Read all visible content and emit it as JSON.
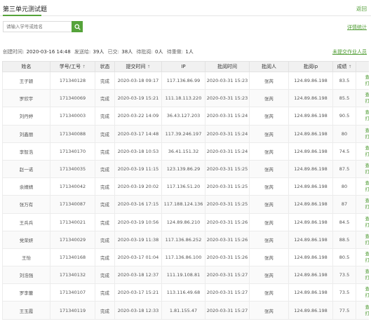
{
  "header": {
    "title": "第三单元测试题",
    "back": "返回"
  },
  "search": {
    "placeholder": "请输入学号或姓名",
    "detail_link": "详情统计"
  },
  "stats": {
    "created_label": "创建时间:",
    "created_value": "2020-03-16 14:48",
    "sent_label": "发送给:",
    "sent_value": "39人",
    "submitted_label": "已交:",
    "submitted_value": "38人",
    "pending_label": "待批阅:",
    "pending_value": "0人",
    "redo_label": "待重做:",
    "redo_value": "1人",
    "unsubmitted_link": "未提交作业人员"
  },
  "table": {
    "headers": [
      "姓名",
      "学号/工号",
      "状态",
      "提交时间",
      "IP",
      "批阅时间",
      "批阅人",
      "批阅ip",
      "成绩",
      ""
    ],
    "actions": {
      "view": "查看",
      "redo": "打回"
    },
    "rows": [
      [
        "王子颖",
        "171340128",
        "完成",
        "2020-03-18 09:17",
        "117.136.86.99",
        "2020-03-31 15:23",
        "张芮",
        "124.89.86.198",
        "83.5"
      ],
      [
        "罗欣宇",
        "171340069",
        "完成",
        "2020-03-19 15:21",
        "111.18.113.220",
        "2020-03-31 15:23",
        "张芮",
        "124.89.86.198",
        "85.5"
      ],
      [
        "刘丹婷",
        "171340003",
        "完成",
        "2020-03-22 14:09",
        "36.43.127.203",
        "2020-03-31 15:24",
        "张芮",
        "124.89.86.198",
        "90.5"
      ],
      [
        "刘鑫丽",
        "171340088",
        "完成",
        "2020-03-17 14:48",
        "117.39.246.197",
        "2020-03-31 15:24",
        "张芮",
        "124.89.86.198",
        "80"
      ],
      [
        "李智浩",
        "171340170",
        "完成",
        "2020-03-18 10:53",
        "36.41.151.32",
        "2020-03-31 15:24",
        "张芮",
        "124.89.86.198",
        "74.5"
      ],
      [
        "赵一诺",
        "171340035",
        "完成",
        "2020-03-19 11:15",
        "123.139.86.29",
        "2020-03-31 15:25",
        "张芮",
        "124.89.86.198",
        "87.5"
      ],
      [
        "余婧婧",
        "171340042",
        "完成",
        "2020-03-19 20:02",
        "117.136.51.20",
        "2020-03-31 15:25",
        "张芮",
        "124.89.86.198",
        "80"
      ],
      [
        "张万有",
        "171340087",
        "完成",
        "2020-03-16 17:15",
        "117.188.124.136",
        "2020-03-31 15:25",
        "张芮",
        "124.89.86.198",
        "87"
      ],
      [
        "王兵兵",
        "171340021",
        "完成",
        "2020-03-19 10:56",
        "124.89.86.210",
        "2020-03-31 15:26",
        "张芮",
        "124.89.86.198",
        "84.5"
      ],
      [
        "党荣妍",
        "171340029",
        "完成",
        "2020-03-19 11:38",
        "117.136.86.252",
        "2020-03-31 15:26",
        "张芮",
        "124.89.86.198",
        "88.5"
      ],
      [
        "王怡",
        "171340168",
        "完成",
        "2020-03-17 01:04",
        "117.136.86.100",
        "2020-03-31 15:26",
        "张芮",
        "124.89.86.198",
        "80.5"
      ],
      [
        "刘浩强",
        "171340132",
        "完成",
        "2020-03-18 12:37",
        "111.19.108.81",
        "2020-03-31 15:27",
        "张芮",
        "124.89.86.198",
        "73.5"
      ],
      [
        "罗李蕾",
        "171340107",
        "完成",
        "2020-03-17 15:21",
        "113.116.49.68",
        "2020-03-31 15:27",
        "张芮",
        "124.89.86.198",
        "73.5"
      ],
      [
        "王玉霞",
        "171340119",
        "完成",
        "2020-03-18 12:33",
        "1.81.155.47",
        "2020-03-31 15:27",
        "张芮",
        "124.89.86.198",
        "77.5"
      ]
    ]
  },
  "colors": {
    "accent": "#55a33a",
    "link": "#4f9c33",
    "header_bg": "#f1f1f1"
  },
  "icons": {
    "search": "search-icon",
    "sort": "sort-arrow-icon"
  }
}
